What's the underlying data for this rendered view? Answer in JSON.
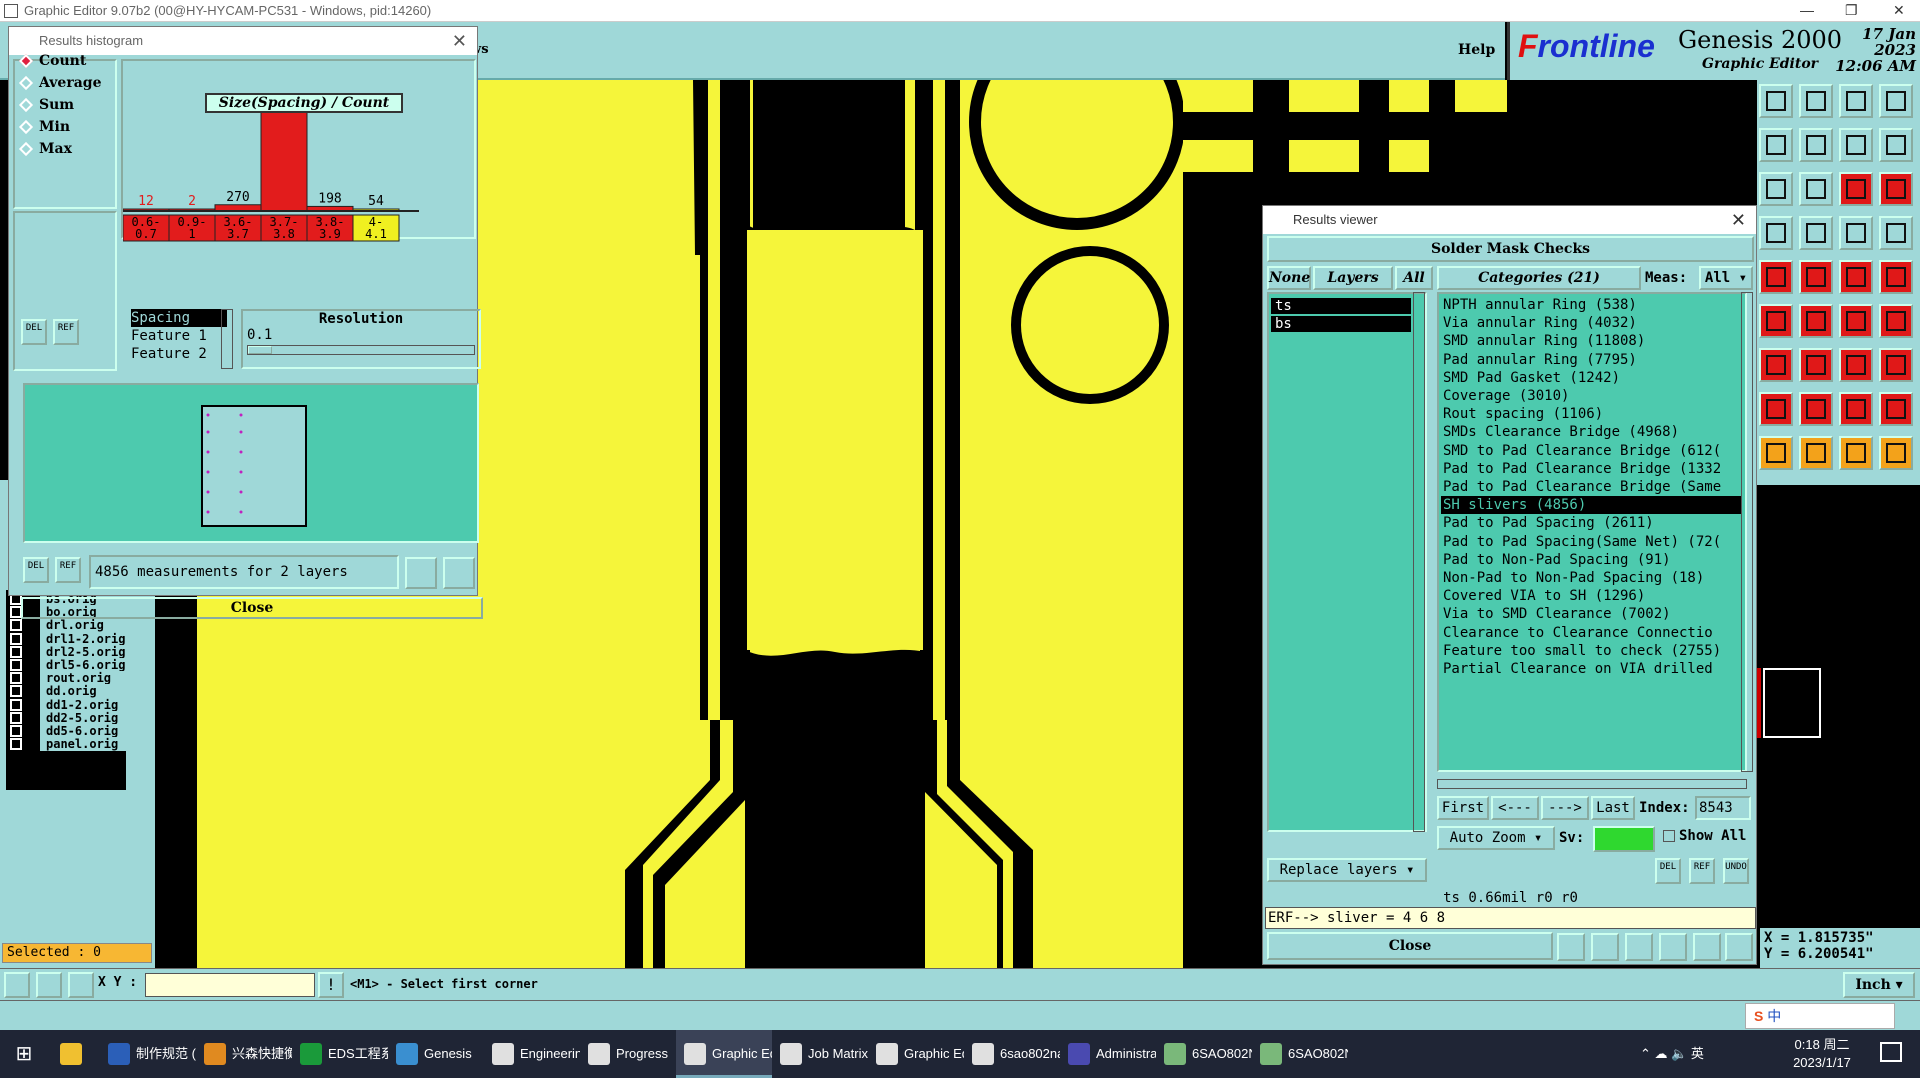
{
  "window": {
    "title": "Graphic Editor 9.07b2 (00@HY-HYCAM-PC531 - Windows, pid:14260)"
  },
  "menubar": {
    "help": "Help",
    "partial": "ws"
  },
  "brand": {
    "logo_pre": "F",
    "logo_rest": "rontline",
    "product": "Genesis 2000",
    "subtitle": "Graphic Editor",
    "date": "17 Jan 2023",
    "time": "12:06 AM"
  },
  "histogram": {
    "title": "Results histogram",
    "close_label": "Close",
    "modes": [
      {
        "label": "Count",
        "selected": true
      },
      {
        "label": "Average",
        "selected": false
      },
      {
        "label": "Sum",
        "selected": false
      },
      {
        "label": "Min",
        "selected": false
      },
      {
        "label": "Max",
        "selected": false
      }
    ],
    "del": "DEL",
    "ref": "REF",
    "spec": [
      "Spacing",
      "Feature 1",
      "Feature 2"
    ],
    "resolution_label": "Resolution",
    "resolution_value": "0.1",
    "measurements": "4856 measurements for 2 layers"
  },
  "chart_data": {
    "type": "bar",
    "title": "Size(Spacing) / Count",
    "categories": [
      "0.6-0.7",
      "0.9-1",
      "3.6-3.7",
      "3.7-3.8",
      "3.8-3.9",
      "4-4.1"
    ],
    "category_lines": [
      [
        "0.6-",
        "0.7"
      ],
      [
        "0.9-",
        "1"
      ],
      [
        "3.6-",
        "3.7"
      ],
      [
        "3.7-",
        "3.8"
      ],
      [
        "3.8-",
        "3.9"
      ],
      [
        "4-",
        "4.1"
      ]
    ],
    "values": [
      12,
      2,
      270,
      4320,
      198,
      54
    ],
    "ylim": [
      0,
      4320
    ],
    "colors": [
      "#e21c1c",
      "#e21c1c",
      "#e21c1c",
      "#e21c1c",
      "#e21c1c",
      "#f0f020"
    ],
    "label_colors": [
      "#e21c1c",
      "#e21c1c",
      "#000000",
      "#000000",
      "#000000",
      "#000000"
    ]
  },
  "layers": [
    "bs.orig",
    "bo.orig",
    "drl.orig",
    "drl1-2.orig",
    "drl2-5.orig",
    "drl5-6.orig",
    "rout.orig",
    "dd.orig",
    "dd1-2.orig",
    "dd2-5.orig",
    "dd5-6.orig",
    "panel.orig"
  ],
  "selected": "Selected : 0",
  "bottom": {
    "xy_label": "X Y :",
    "hint": "<M1> - Select first corner",
    "units": "Inch"
  },
  "coords": {
    "x": "X = 1.815735\"",
    "y": "Y = 6.200541\""
  },
  "results": {
    "title": "Results viewer",
    "header": "Solder Mask Checks",
    "none": "None",
    "layers_label": "Layers",
    "all": "All",
    "categories_label": "Categories (21)",
    "meas_label": "Meas:",
    "meas_value": "All",
    "layer_items": [
      "ts",
      "bs"
    ],
    "categories": [
      "NPTH annular Ring (538)",
      "Via annular Ring (4032)",
      "SMD annular Ring (11808)",
      "Pad annular Ring (7795)",
      "SMD Pad Gasket (1242)",
      "Coverage (3010)",
      "Rout spacing (1106)",
      "SMDs Clearance Bridge (4968)",
      "SMD to Pad Clearance Bridge (612(",
      "Pad to Pad Clearance Bridge (1332",
      "Pad to Pad Clearance Bridge (Same",
      "SH slivers (4856)",
      "Pad to Pad Spacing (2611)",
      "Pad to Pad Spacing(Same Net) (72(",
      "Pad to Non-Pad Spacing (91)",
      "Non-Pad to Non-Pad Spacing (18)",
      "Covered VIA to SH (1296)",
      "Via to SMD Clearance (7002)",
      "Clearance to Clearance Connectio",
      "Feature too small to check (2755)",
      "Partial Clearance on VIA drilled"
    ],
    "selected_index": 11,
    "nav": {
      "first": "First",
      "prev": "<---",
      "next": "--->",
      "last": "Last",
      "index_label": "Index:",
      "index_value": "8543"
    },
    "auto_zoom": "Auto Zoom",
    "sv": "Sv:",
    "show_all": "Show All",
    "replace": "Replace layers",
    "status": "ts 0.66mil  r0  r0",
    "erf": "ERF--> sliver = 4 6 8",
    "close": "Close",
    "del": "DEL",
    "ref": "REF",
    "undo": "UNDO"
  },
  "taskbar": [
    {
      "label": "制作规范 (V...",
      "color": "#2b5fb8"
    },
    {
      "label": "兴森快捷衡...",
      "color": "#e08a20"
    },
    {
      "label": "EDS工程系统",
      "color": "#1a9a3a"
    },
    {
      "label": "Genesis",
      "color": "#3a8fd0"
    },
    {
      "label": "Engineerin...",
      "color": "#e0e0e0"
    },
    {
      "label": "Progress",
      "color": "#e0e0e0"
    },
    {
      "label": "Graphic Ed...",
      "color": "#e0e0e0"
    },
    {
      "label": "Job Matrix...",
      "color": "#e0e0e0"
    },
    {
      "label": "Graphic Ed...",
      "color": "#e0e0e0"
    },
    {
      "label": "6sao802na...",
      "color": "#e0e0e0"
    },
    {
      "label": "Administra...",
      "color": "#4a4ab0"
    },
    {
      "label": "6SAO802N...",
      "color": "#7ab87a"
    },
    {
      "label": "6SAO802N...",
      "color": "#7ab87a"
    }
  ],
  "tray": {
    "ime": "英",
    "time": "0:18 周二",
    "date": "2023/1/17",
    "ime2": "中"
  }
}
